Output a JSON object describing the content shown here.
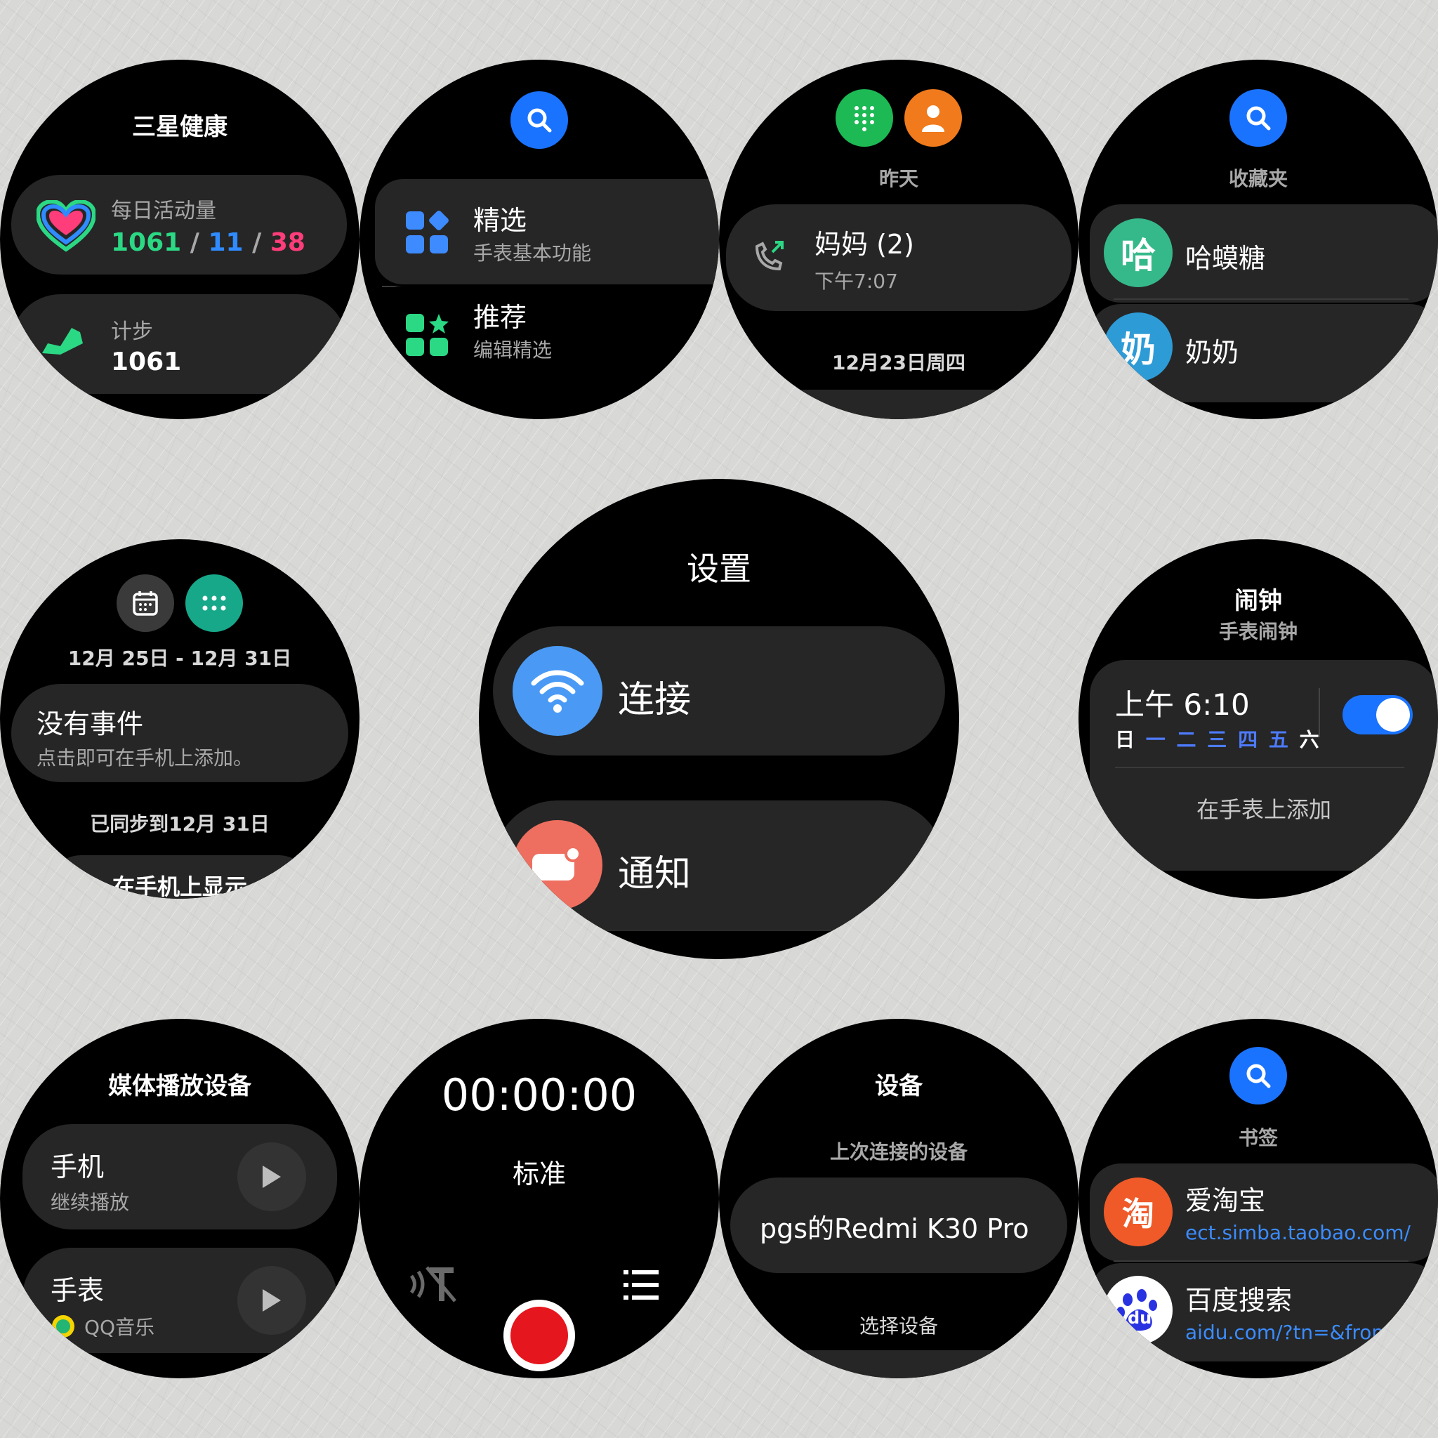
{
  "health": {
    "title": "三星健康",
    "activity_label": "每日活动量",
    "activity_steps": "1061",
    "activity_sep1": "/",
    "activity_minutes": "11",
    "activity_sep2": "/",
    "activity_calories": "38",
    "steps_label": "计步",
    "steps_value": "1061"
  },
  "tiles": {
    "item1_title": "精选",
    "item1_sub": "手表基本功能",
    "item2_title": "推荐",
    "item2_sub": "编辑精选"
  },
  "phone": {
    "section_yesterday": "昨天",
    "contact": "妈妈 (2)",
    "time": "下午7:07",
    "section_date": "12月23日周四"
  },
  "contacts": {
    "section": "收藏夹",
    "c1_avatar": "哈",
    "c1_name": "哈蟆糖",
    "c2_avatar": "奶",
    "c2_name": "奶奶"
  },
  "calendar": {
    "range": "12月 25日 - 12月 31日",
    "no_events": "没有事件",
    "hint": "点击即可在手机上添加。",
    "synced": "已同步到12月 31日",
    "show_on_phone": "在手机上显示"
  },
  "settings": {
    "title": "设置",
    "item1": "连接",
    "item2": "通知"
  },
  "alarm": {
    "title": "闹钟",
    "subtitle": "手表闹钟",
    "time": "上午 6:10",
    "days": [
      "日",
      "一",
      "二",
      "三",
      "四",
      "五",
      "六"
    ],
    "add": "在手表上添加",
    "enabled": true
  },
  "media": {
    "title": "媒体播放设备",
    "item1_title": "手机",
    "item1_sub": "继续播放",
    "item2_title": "手表",
    "item2_sub": "QQ音乐"
  },
  "recorder": {
    "timer": "00:00:00",
    "mode": "标准"
  },
  "devices": {
    "title": "设备",
    "last_connected_label": "上次连接的设备",
    "device_name": "pgs的Redmi K30 Pro",
    "select": "选择设备"
  },
  "browser": {
    "section": "书签",
    "b1_icon": "淘",
    "b1_title": "爱淘宝",
    "b1_url": "ect.simba.taobao.com/",
    "b2_icon": "du",
    "b2_title": "百度搜索",
    "b2_url": "aidu.com/?tn=&from="
  },
  "colors": {
    "green": "#2bd884",
    "blue": "#2f8bff",
    "pink": "#ff3d7a",
    "accent_blue": "#1a73ff",
    "record_red": "#e5161d"
  }
}
